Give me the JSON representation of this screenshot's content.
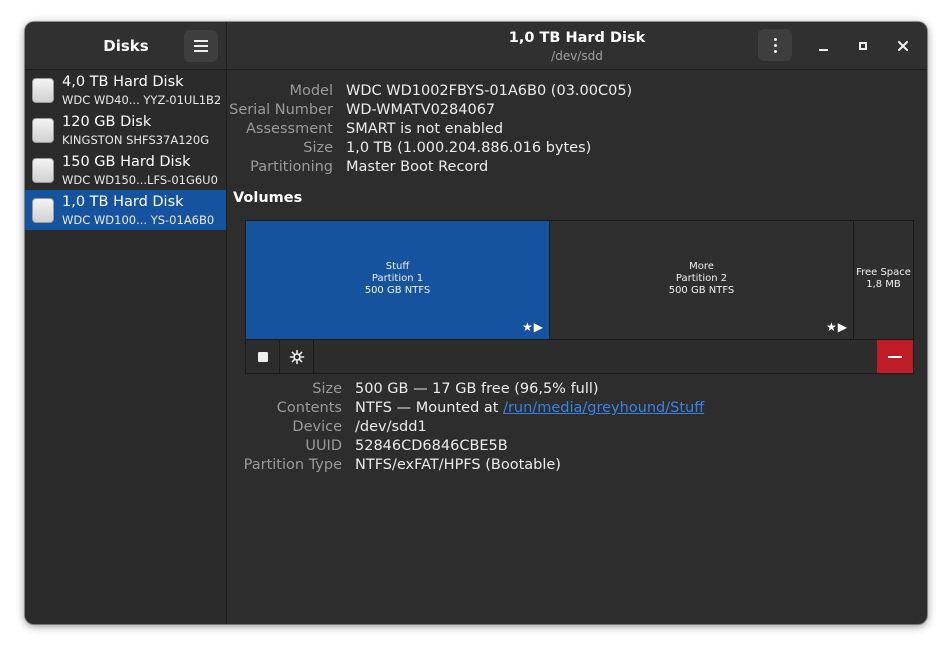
{
  "sidebar": {
    "title": "Disks",
    "disks": [
      {
        "name": "4,0 TB Hard Disk",
        "model": "WDC WD40... YYZ-01UL1B2"
      },
      {
        "name": "120 GB Disk",
        "model": "KINGSTON SHFS37A120G"
      },
      {
        "name": "150 GB Hard Disk",
        "model": "WDC WD150...LFS-01G6U0"
      },
      {
        "name": "1,0 TB Hard Disk",
        "model": "WDC WD100...  YS-01A6B0",
        "selected": true
      }
    ]
  },
  "header": {
    "title": "1,0 TB Hard Disk",
    "subtitle": "/dev/sdd"
  },
  "disk_info": {
    "model_label": "Model",
    "model": "WDC WD1002FBYS-01A6B0 (03.00C05)",
    "serial_label": "Serial Number",
    "serial": "WD-WMATV0284067",
    "assessment_label": "Assessment",
    "assessment": "SMART is not enabled",
    "size_label": "Size",
    "size": "1,0 TB (1.000.204.886.016 bytes)",
    "partitioning_label": "Partitioning",
    "partitioning": "Master Boot Record"
  },
  "volumes": {
    "heading": "Volumes",
    "partitions": [
      {
        "name": "Stuff",
        "label": "Partition 1",
        "size": "500 GB NTFS",
        "selected": true
      },
      {
        "name": "More",
        "label": "Partition 2",
        "size": "500 GB NTFS"
      },
      {
        "name": "Free Space",
        "size": "1,8 MB"
      }
    ]
  },
  "partition_info": {
    "size_label": "Size",
    "size": "500 GB — 17 GB free (96,5% full)",
    "contents_label": "Contents",
    "contents_prefix": "NTFS — Mounted at ",
    "contents_link": "/run/media/greyhound/Stuff",
    "device_label": "Device",
    "device": "/dev/sdd1",
    "uuid_label": "UUID",
    "uuid": "52846CD6846CBE5B",
    "type_label": "Partition Type",
    "type": "NTFS/exFAT/HPFS (Bootable)"
  },
  "colors": {
    "accent": "#15539e",
    "link": "#3584e4",
    "destructive": "#c01c28"
  },
  "icons": [
    "menu-icon",
    "kebab-menu-icon",
    "minimize-icon",
    "maximize-icon",
    "close-icon",
    "disk-icon",
    "star-icon",
    "play-icon",
    "stop-icon",
    "gear-icon",
    "remove-icon"
  ]
}
